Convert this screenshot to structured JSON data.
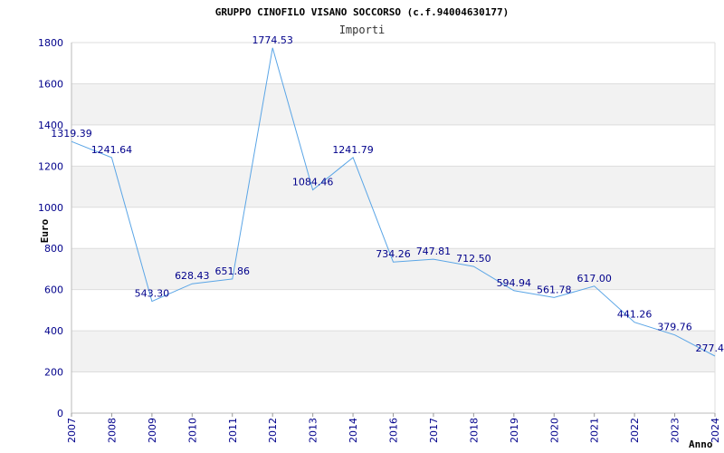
{
  "chart_data": {
    "type": "line",
    "title": "GRUPPO CINOFILO VISANO SOCCORSO (c.f.94004630177)",
    "subtitle": "Importi",
    "xlabel": "Anno",
    "ylabel": "Euro",
    "ylim": [
      0,
      1800
    ],
    "yticks": [
      "0",
      "200",
      "400",
      "600",
      "800",
      "1000",
      "1200",
      "1400",
      "1600",
      "1800"
    ],
    "grid": "alternating horizontal bands",
    "colors": {
      "line": "#5aa5e6",
      "band": "#f2f2f2",
      "grid": "#dddddd",
      "tick_text": "#00008b"
    },
    "categories": [
      "2007",
      "2008",
      "2009",
      "2010",
      "2011",
      "2012",
      "2013",
      "2014",
      "2016",
      "2017",
      "2018",
      "2019",
      "2020",
      "2021",
      "2022",
      "2023",
      "2024"
    ],
    "values": [
      1319.39,
      1241.64,
      543.3,
      628.43,
      651.86,
      1774.53,
      1084.46,
      1241.79,
      734.26,
      747.81,
      712.5,
      594.94,
      561.78,
      617.0,
      441.26,
      379.76,
      277.4
    ],
    "labels": [
      "1319.39",
      "1241.64",
      "543.30",
      "628.43",
      "651.86",
      "1774.53",
      "1084.46",
      "1241.79",
      "734.26",
      "747.81",
      "712.50",
      "594.94",
      "561.78",
      "617.00",
      "441.26",
      "379.76",
      "277.4"
    ]
  }
}
